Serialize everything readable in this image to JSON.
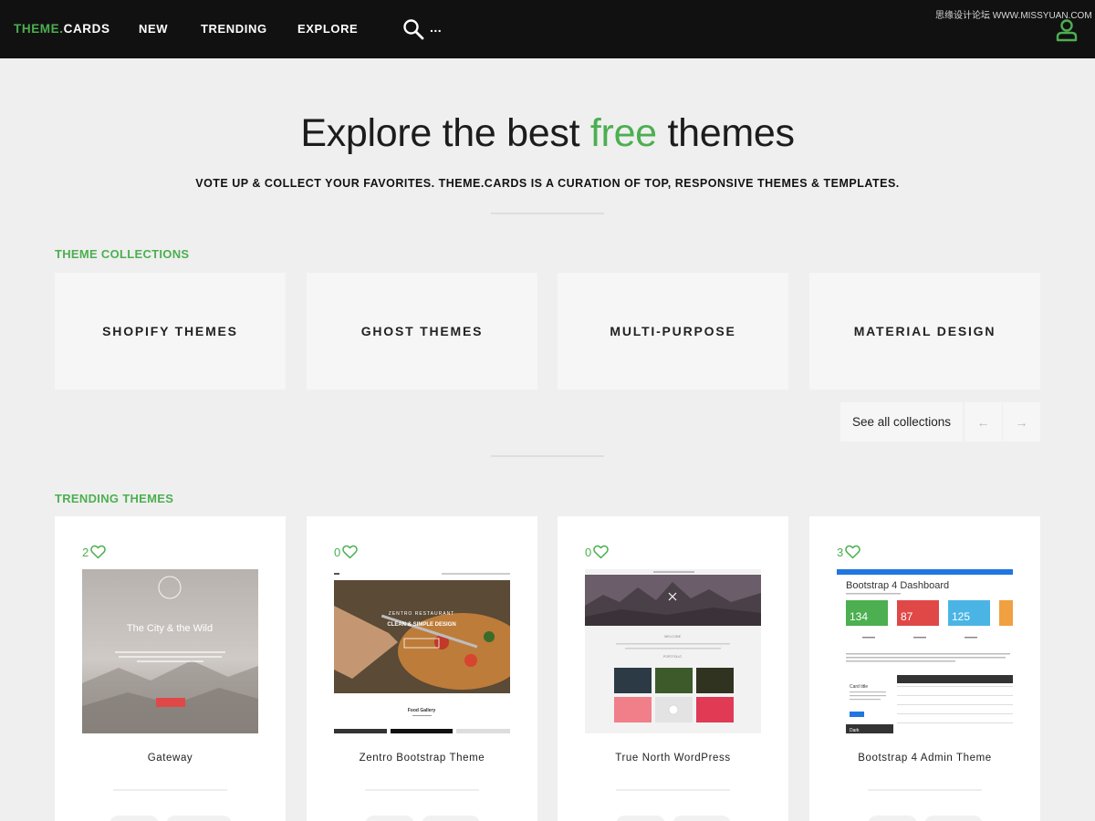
{
  "nav": {
    "brand_part1": "THEME.",
    "brand_part2": "CARDS",
    "links": [
      "NEW",
      "TRENDING",
      "EXPLORE"
    ],
    "more": "...",
    "icons": [
      "search-icon",
      "user-icon"
    ]
  },
  "watermark": "思缘设计论坛 WWW.MISSYUAN.COM",
  "hero": {
    "title_pre": "Explore the best ",
    "title_accent": "free",
    "title_post": " themes",
    "subtitle": "VOTE UP & COLLECT YOUR FAVORITES. THEME.CARDS IS A CURATION OF TOP, RESPONSIVE THEMES & TEMPLATES."
  },
  "collections": {
    "heading": "THEME COLLECTIONS",
    "items": [
      "SHOPIFY THEMES",
      "GHOST THEMES",
      "MULTI-PURPOSE",
      "MATERIAL DESIGN"
    ],
    "see_all": "See all collections",
    "prev": "←",
    "next": "→"
  },
  "trending": {
    "heading": "TRENDING THEMES",
    "items": [
      {
        "likes": "2",
        "name": "Gateway",
        "thumb_title": "The City & the Wild"
      },
      {
        "likes": "0",
        "name": "Zentro Bootstrap Theme",
        "thumb_brand": "ZENTRO RESTAURANT",
        "thumb_tagline": "CLEAN & SIMPLE DESIGN",
        "thumb_section": "Food Gallery"
      },
      {
        "likes": "0",
        "name": "True North WordPress",
        "thumb_label_1": "WELCOME",
        "thumb_label_2": "PORTFOLIO"
      },
      {
        "likes": "3",
        "name": "Bootstrap 4 Admin Theme",
        "thumb_title": "Bootstrap 4 Dashboard",
        "thumb_stats": [
          "134",
          "87",
          "125"
        ],
        "thumb_stat_colors": [
          "#4caf50",
          "#e04848",
          "#4ab5e5",
          "#f0a040"
        ],
        "thumb_card_title": "Card title",
        "thumb_dark_label": "Dark"
      }
    ]
  },
  "colors": {
    "accent": "#4caf50",
    "navbar": "#111111",
    "page_bg": "#efefef",
    "card_bg": "#f6f6f6"
  }
}
